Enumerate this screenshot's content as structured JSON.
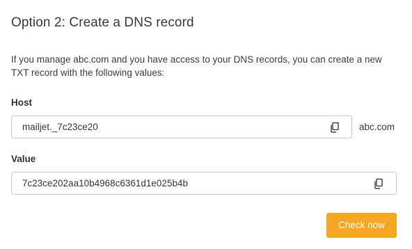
{
  "title": "Option 2: Create a DNS record",
  "description": "If you manage abc.com and you have access to your DNS records, you can create a new TXT record with the following values:",
  "host": {
    "label": "Host",
    "value": "mailjet._7c23ce20",
    "suffix": "abc.com",
    "copy_icon": "copy-icon"
  },
  "value_field": {
    "label": "Value",
    "value": "7c23ce202aa10b4968c6361d1e025b4b",
    "copy_icon": "copy-icon"
  },
  "button": {
    "label": "Check now",
    "color": "#f5a623"
  }
}
